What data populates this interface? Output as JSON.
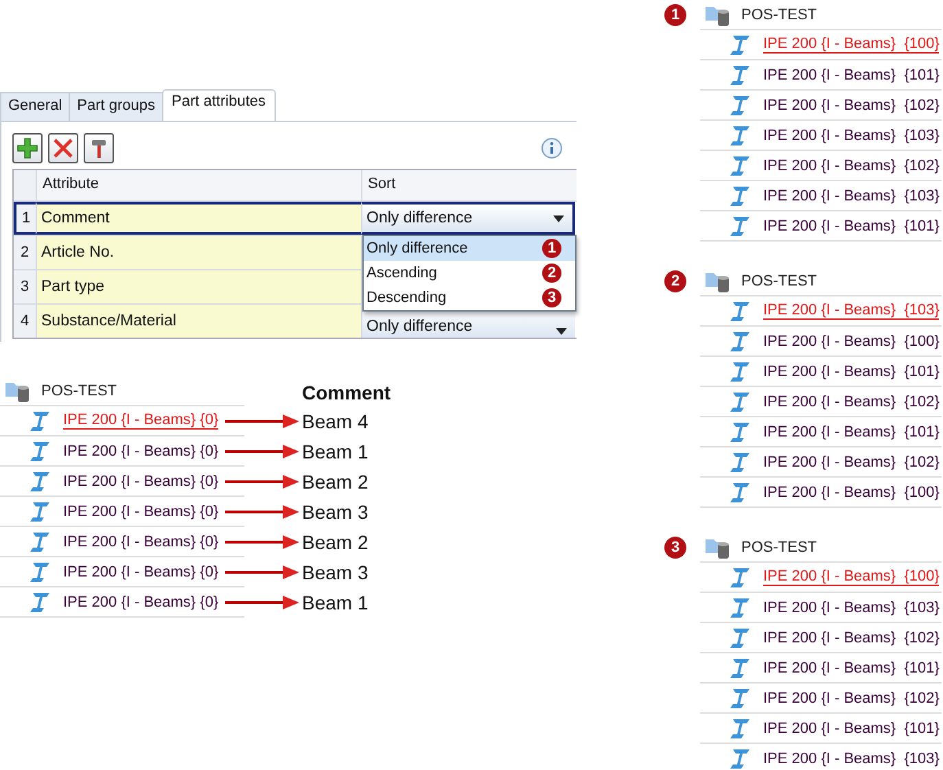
{
  "settings_panel": {
    "tabs": [
      {
        "label": "General",
        "selected": false
      },
      {
        "label": "Part groups",
        "selected": false
      },
      {
        "label": "Part attributes",
        "selected": true
      }
    ],
    "grid": {
      "columns": [
        "Attribute",
        "Sort"
      ],
      "rows": [
        {
          "number": "1",
          "attribute": "Comment",
          "sort": "Only difference",
          "selected": true
        },
        {
          "number": "2",
          "attribute": "Article No.",
          "selected": false
        },
        {
          "number": "3",
          "attribute": "Part type",
          "selected": false
        },
        {
          "number": "4",
          "attribute": "Substance/Material",
          "sort": "Only difference",
          "selected": false
        }
      ]
    },
    "dropdown": {
      "options": [
        {
          "label": "Only difference",
          "badge": "1",
          "selected": true
        },
        {
          "label": "Ascending",
          "badge": "2",
          "selected": false
        },
        {
          "label": "Descending",
          "badge": "3",
          "selected": false
        }
      ]
    }
  },
  "example_tree": {
    "root": "POS-TEST",
    "comment_heading": "Comment",
    "items": [
      {
        "label": "IPE 200 {I - Beams} {0}",
        "comment": "Beam 4",
        "selected": true
      },
      {
        "label": "IPE 200 {I - Beams} {0}",
        "comment": "Beam 1",
        "selected": false
      },
      {
        "label": "IPE 200 {I - Beams} {0}",
        "comment": "Beam 2",
        "selected": false
      },
      {
        "label": "IPE 200 {I - Beams} {0}",
        "comment": "Beam 3",
        "selected": false
      },
      {
        "label": "IPE 200 {I - Beams} {0}",
        "comment": "Beam 2",
        "selected": false
      },
      {
        "label": "IPE 200 {I - Beams} {0}",
        "comment": "Beam 3",
        "selected": false
      },
      {
        "label": "IPE 200 {I - Beams} {0}",
        "comment": "Beam 1",
        "selected": false
      }
    ]
  },
  "sorted_trees": [
    {
      "badge": "1",
      "root": "POS-TEST",
      "items": [
        {
          "label": "IPE 200 {I - Beams}  {100}",
          "selected": true
        },
        {
          "label": "IPE 200 {I - Beams}  {101}",
          "selected": false
        },
        {
          "label": "IPE 200 {I - Beams}  {102}",
          "selected": false
        },
        {
          "label": "IPE 200 {I - Beams}  {103}",
          "selected": false
        },
        {
          "label": "IPE 200 {I - Beams}  {102}",
          "selected": false
        },
        {
          "label": "IPE 200 {I - Beams}  {103}",
          "selected": false
        },
        {
          "label": "IPE 200 {I - Beams}  {101}",
          "selected": false
        }
      ]
    },
    {
      "badge": "2",
      "root": "POS-TEST",
      "items": [
        {
          "label": "IPE 200 {I - Beams}  {103}",
          "selected": true
        },
        {
          "label": "IPE 200 {I - Beams}  {100}",
          "selected": false
        },
        {
          "label": "IPE 200 {I - Beams}  {101}",
          "selected": false
        },
        {
          "label": "IPE 200 {I - Beams}  {102}",
          "selected": false
        },
        {
          "label": "IPE 200 {I - Beams}  {101}",
          "selected": false
        },
        {
          "label": "IPE 200 {I - Beams}  {102}",
          "selected": false
        },
        {
          "label": "IPE 200 {I - Beams}  {100}",
          "selected": false
        }
      ]
    },
    {
      "badge": "3",
      "root": "POS-TEST",
      "items": [
        {
          "label": "IPE 200 {I - Beams}  {100}",
          "selected": true
        },
        {
          "label": "IPE 200 {I - Beams}  {103}",
          "selected": false
        },
        {
          "label": "IPE 200 {I - Beams}  {102}",
          "selected": false
        },
        {
          "label": "IPE 200 {I - Beams}  {101}",
          "selected": false
        },
        {
          "label": "IPE 200 {I - Beams}  {102}",
          "selected": false
        },
        {
          "label": "IPE 200 {I - Beams}  {101}",
          "selected": false
        },
        {
          "label": "IPE 200 {I - Beams}  {103}",
          "selected": false
        }
      ]
    }
  ]
}
